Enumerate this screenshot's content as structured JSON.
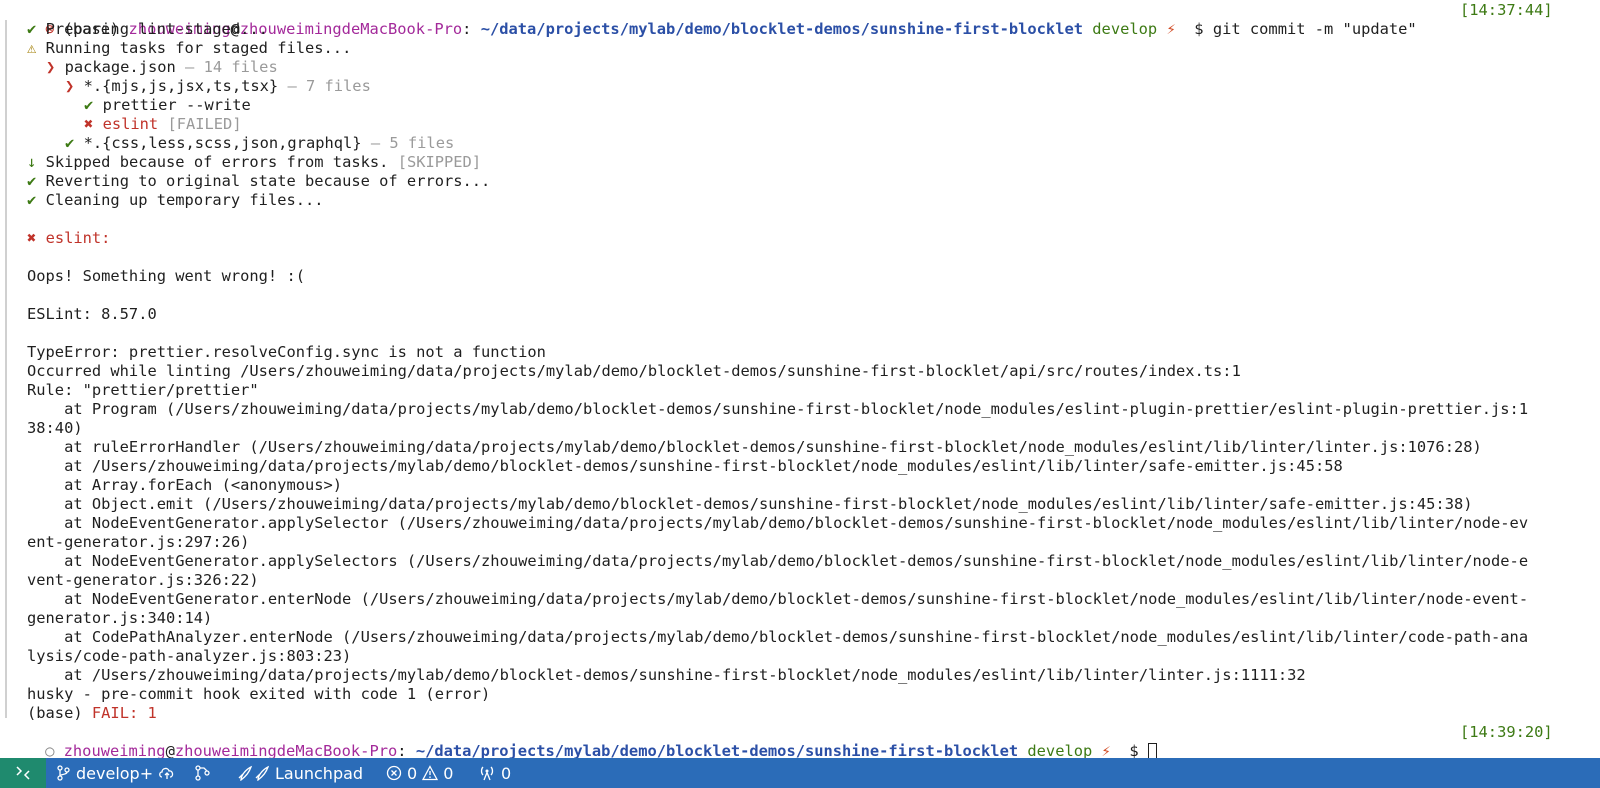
{
  "prompt1": {
    "indicator": "⊗",
    "env": "(base)",
    "user": "zhouweiming",
    "at": "@",
    "host": "zhouweimingdeMacBook-Pro",
    "colon": ":",
    "path": "~/data/projects/mylab/demo/blocklet-demos/sunshine-first-blocklet",
    "branch": "develop",
    "bolt": "⚡",
    "dollar": "$",
    "command": "git commit -m \"update\"",
    "time": "[14:37:44]"
  },
  "lint_tasks": {
    "l1": {
      "mark": "✔",
      "text": "Preparing lint-staged..."
    },
    "l2": {
      "mark": "⚠",
      "text": "Running tasks for staged files..."
    },
    "l3": {
      "mark": "❯",
      "text": "package.json",
      "extra": "— 14 files"
    },
    "l4": {
      "mark": "❯",
      "text": "*.{mjs,js,jsx,ts,tsx}",
      "extra": "— 7 files"
    },
    "l5": {
      "mark": "✔",
      "text": "prettier --write"
    },
    "l6": {
      "mark": "✖",
      "text": "eslint",
      "extra": "[FAILED]"
    },
    "l7": {
      "mark": "✔",
      "text": "*.{css,less,scss,json,graphql}",
      "extra": "— 5 files"
    },
    "l8": {
      "mark": "↓",
      "text": "Skipped because of errors from tasks.",
      "extra": "[SKIPPED]"
    },
    "l9": {
      "mark": "✔",
      "text": "Reverting to original state because of errors..."
    },
    "l10": {
      "mark": "✔",
      "text": "Cleaning up temporary files..."
    }
  },
  "error_header": {
    "mark": "✖",
    "text": "eslint:"
  },
  "output": {
    "o1": "Oops! Something went wrong! :(",
    "o2": "ESLint: 8.57.0",
    "o3": "TypeError: prettier.resolveConfig.sync is not a function",
    "o4": "Occurred while linting /Users/zhouweiming/data/projects/mylab/demo/blocklet-demos/sunshine-first-blocklet/api/src/routes/index.ts:1",
    "o5": "Rule: \"prettier/prettier\"",
    "o6": "    at Program (/Users/zhouweiming/data/projects/mylab/demo/blocklet-demos/sunshine-first-blocklet/node_modules/eslint-plugin-prettier/eslint-plugin-prettier.js:1",
    "o7": "38:40)",
    "o8": "    at ruleErrorHandler (/Users/zhouweiming/data/projects/mylab/demo/blocklet-demos/sunshine-first-blocklet/node_modules/eslint/lib/linter/linter.js:1076:28)",
    "o9": "    at /Users/zhouweiming/data/projects/mylab/demo/blocklet-demos/sunshine-first-blocklet/node_modules/eslint/lib/linter/safe-emitter.js:45:58",
    "o10": "    at Array.forEach (<anonymous>)",
    "o11": "    at Object.emit (/Users/zhouweiming/data/projects/mylab/demo/blocklet-demos/sunshine-first-blocklet/node_modules/eslint/lib/linter/safe-emitter.js:45:38)",
    "o12": "    at NodeEventGenerator.applySelector (/Users/zhouweiming/data/projects/mylab/demo/blocklet-demos/sunshine-first-blocklet/node_modules/eslint/lib/linter/node-ev",
    "o13": "ent-generator.js:297:26)",
    "o14": "    at NodeEventGenerator.applySelectors (/Users/zhouweiming/data/projects/mylab/demo/blocklet-demos/sunshine-first-blocklet/node_modules/eslint/lib/linter/node-e",
    "o15": "vent-generator.js:326:22)",
    "o16": "    at NodeEventGenerator.enterNode (/Users/zhouweiming/data/projects/mylab/demo/blocklet-demos/sunshine-first-blocklet/node_modules/eslint/lib/linter/node-event-",
    "o17": "generator.js:340:14)",
    "o18": "    at CodePathAnalyzer.enterNode (/Users/zhouweiming/data/projects/mylab/demo/blocklet-demos/sunshine-first-blocklet/node_modules/eslint/lib/linter/code-path-ana",
    "o19": "lysis/code-path-analyzer.js:803:23)",
    "o20": "    at /Users/zhouweiming/data/projects/mylab/demo/blocklet-demos/sunshine-first-blocklet/node_modules/eslint/lib/linter/linter.js:1111:32",
    "o21": "husky - pre-commit hook exited with code 1 (error)"
  },
  "fail_line": {
    "env": "(base)",
    "fail": "FAIL: 1"
  },
  "prompt2": {
    "indicator": "○",
    "user": "zhouweiming",
    "at": "@",
    "host": "zhouweimingdeMacBook-Pro",
    "colon": ":",
    "path": "~/data/projects/mylab/demo/blocklet-demos/sunshine-first-blocklet",
    "branch": "develop",
    "bolt": "⚡",
    "dollar": "$",
    "time": "[14:39:20]"
  },
  "status_bar": {
    "branch": "develop+",
    "launchpad": "Launchpad",
    "errors": "0",
    "warnings": "0",
    "ports": "0"
  },
  "colors": {
    "status_bar_bg": "#2b6cb8",
    "remote_bg": "#1f8a6e",
    "success": "#3d7a14",
    "error": "#c0332a",
    "path": "#2b4fa6",
    "user": "#a3299a"
  }
}
